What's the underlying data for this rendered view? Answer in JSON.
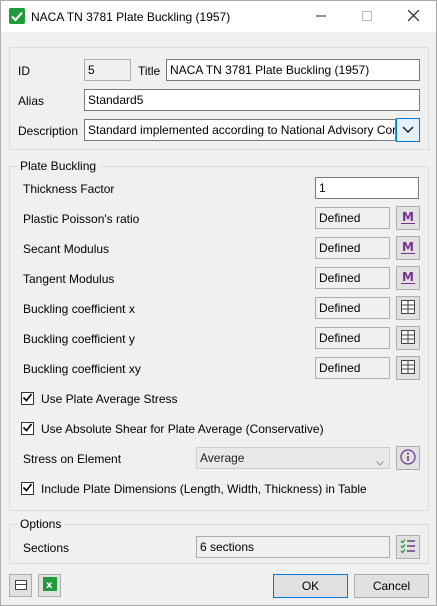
{
  "window": {
    "title": "NACA TN 3781 Plate Buckling (1957)",
    "minimize_icon": "minimize-icon",
    "maximize_icon": "maximize-icon",
    "close_icon": "close-icon"
  },
  "header": {
    "id_label": "ID",
    "id_value": "5",
    "title_label": "Title",
    "title_value": "NACA TN 3781 Plate Buckling (1957)",
    "alias_label": "Alias",
    "alias_value": "Standard5",
    "description_label": "Description",
    "description_value": "Standard implemented according to National Advisory Cor"
  },
  "plate_buckling": {
    "group_title": "Plate Buckling",
    "thickness_factor_label": "Thickness Factor",
    "thickness_factor_value": "1",
    "rows": [
      {
        "label": "Plastic Poisson's ratio",
        "value": "Defined",
        "icon": "material-icon"
      },
      {
        "label": "Secant Modulus",
        "value": "Defined",
        "icon": "material-icon"
      },
      {
        "label": "Tangent Modulus",
        "value": "Defined",
        "icon": "material-icon"
      },
      {
        "label": "Buckling coefficient x",
        "value": "Defined",
        "icon": "table-icon"
      },
      {
        "label": "Buckling coefficient y",
        "value": "Defined",
        "icon": "table-icon"
      },
      {
        "label": "Buckling coefficient xy",
        "value": "Defined",
        "icon": "table-icon"
      }
    ],
    "use_plate_average_label": "Use Plate Average Stress",
    "use_abs_shear_label": "Use Absolute Shear for Plate Average (Conservative)",
    "stress_on_element_label": "Stress on Element",
    "stress_on_element_value": "Average",
    "include_dims_label": "Include Plate Dimensions (Length, Width, Thickness) in Table"
  },
  "options": {
    "group_title": "Options",
    "sections_label": "Sections",
    "sections_value": "6 sections"
  },
  "footer": {
    "ok_label": "OK",
    "cancel_label": "Cancel"
  },
  "colors": {
    "accent": "#0078d7",
    "check_green": "#1e9b3a",
    "material_icon": "#7a2f8f"
  }
}
